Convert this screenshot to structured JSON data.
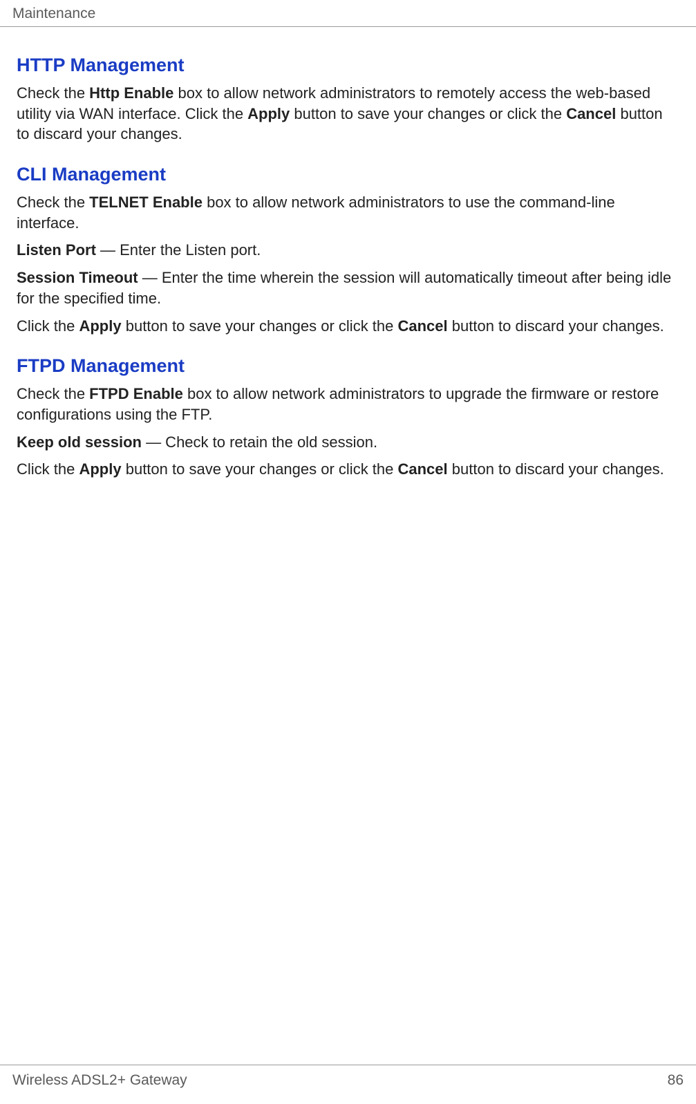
{
  "header": {
    "title": "Maintenance"
  },
  "sections": {
    "http": {
      "heading": "HTTP Management",
      "p1_pre": "Check the ",
      "p1_b1": "Http Enable",
      "p1_mid1": " box to allow network administrators to remotely access the web-based utility via WAN interface. Click the ",
      "p1_b2": "Apply",
      "p1_mid2": " button to save your changes or click the ",
      "p1_b3": "Cancel",
      "p1_post": " button to discard your changes."
    },
    "cli": {
      "heading": "CLI Management",
      "p1_pre": "Check the ",
      "p1_b1": "TELNET Enable",
      "p1_post": " box to allow network administrators to use the command-line interface.",
      "p2_b1": "Listen Port",
      "p2_post": " — Enter the Listen port.",
      "p3_b1": "Session Timeout",
      "p3_post": " — Enter the time wherein the session will automatically timeout after being idle for the specified time.",
      "p4_pre": "Click the ",
      "p4_b1": "Apply",
      "p4_mid1": " button to save your changes or click the ",
      "p4_b2": "Cancel",
      "p4_post": " button to discard your changes."
    },
    "ftpd": {
      "heading": "FTPD Management",
      "p1_pre": "Check the ",
      "p1_b1": "FTPD Enable",
      "p1_post": " box to allow network administrators to upgrade the firmware or restore configurations using the FTP.",
      "p2_b1": "Keep old session",
      "p2_post": " — Check to retain the old session.",
      "p3_pre": "Click the ",
      "p3_b1": "Apply",
      "p3_mid1": " button to save your changes or click the ",
      "p3_b2": "Cancel",
      "p3_post": " button to discard your changes."
    }
  },
  "footer": {
    "product": "Wireless ADSL2+ Gateway",
    "page": "86"
  }
}
